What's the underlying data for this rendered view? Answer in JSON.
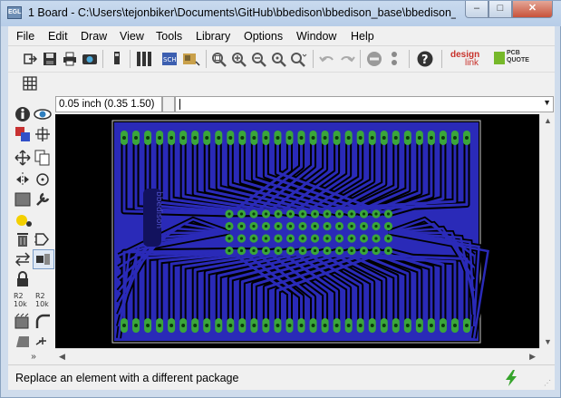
{
  "window": {
    "app_icon": "eagle-app-icon",
    "title": "1 Board - C:\\Users\\tejonbiker\\Documents\\GitHub\\bbedison\\bbedison_base\\bbedison_b...",
    "controls": {
      "minimize": "–",
      "maximize": "□",
      "close": "✕"
    }
  },
  "menu": {
    "items": [
      "File",
      "Edit",
      "Draw",
      "View",
      "Tools",
      "Library",
      "Options",
      "Window",
      "Help"
    ]
  },
  "toolbar": {
    "icons": [
      "open-script-icon",
      "save-icon",
      "print-icon",
      "cam-processor-icon",
      "export-icon",
      "library-icon",
      "schematic-icon",
      "board-icon",
      "zoom-fit-icon",
      "zoom-in-icon",
      "zoom-out-icon",
      "zoom-redraw-icon",
      "zoom-select-icon",
      "undo-icon",
      "redo-icon",
      "stop-icon",
      "go-icon",
      "help-icon"
    ],
    "brand1_line1": "design",
    "brand1_line2": "link",
    "brand2_line1": "PCB",
    "brand2_line2": "QUOTE",
    "brand_color": "#c8312a",
    "quote_color": "#76b82a"
  },
  "toolbar2": {
    "icons": [
      "grid-icon"
    ]
  },
  "coord": {
    "value": "0.05 inch (0.35 1.50)"
  },
  "command": {
    "value": ""
  },
  "toolbox": {
    "icons": [
      "info-icon",
      "show-eye-icon",
      "display-layers-icon",
      "mark-icon",
      "move-icon",
      "copy-icon",
      "mirror-icon",
      "rotate-icon",
      "group-icon",
      "change-wrench-icon",
      "paste-icon",
      "delete-icon",
      "add-part-icon",
      "pinswap-icon",
      "replace-package-icon",
      "lock-icon",
      "name-icon",
      "value-icon",
      "smash-icon",
      "miter-icon",
      "split-icon",
      "optimize-icon",
      "more-tools-icon"
    ]
  },
  "board": {
    "silk_text": "bbedison",
    "colors": {
      "background": "#000000",
      "copper": "#2a2ab8",
      "trace_gap": "#000000",
      "pad": "#3aa63a",
      "outline": "#c8c8c8"
    }
  },
  "status": {
    "text": "Replace an element with a different package",
    "icon": "lightning-icon",
    "icon_color": "#35a42b"
  }
}
